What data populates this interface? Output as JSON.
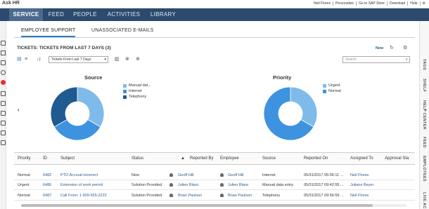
{
  "app": {
    "title": "Ask HR"
  },
  "utility": [
    "Neil Flores",
    "Personalize",
    "Go to SAP Store",
    "Download",
    "Help"
  ],
  "nav": [
    "SERVICE",
    "FEED",
    "PEOPLE",
    "ACTIVITIES",
    "LIBRARY"
  ],
  "subtabs": [
    "EMPLOYEE SUPPORT",
    "UNASSOCIATED E-MAILS"
  ],
  "tickets": {
    "title": "TICKETS: TICKETS FROM LAST 7 DAYS (3)",
    "new_label": "New"
  },
  "filter": {
    "selected": "Tickets From Last 7 Days"
  },
  "search": {
    "placeholder": "Search"
  },
  "charts": {
    "source": {
      "title": "Source",
      "legend": [
        "Manual dat...",
        "Internet",
        "Telephony"
      ],
      "colors": [
        "#7fbbea",
        "#3d93df",
        "#1f5a91"
      ],
      "values": [
        1,
        1,
        1
      ]
    },
    "priority": {
      "title": "Priority",
      "legend": [
        "Urgent",
        "Normal"
      ],
      "colors": [
        "#7fbbea",
        "#3d93df"
      ],
      "values": [
        1,
        2
      ]
    }
  },
  "table": {
    "headers": [
      "Priority",
      "ID",
      "Subject",
      "Status",
      "Reported By",
      "Employee",
      "Source",
      "Reported On",
      "Assigned To",
      "Approval Sta"
    ],
    "rows": [
      [
        "Normal",
        "6482",
        "PTO Accrual incorrect",
        "New",
        "Geoff Hill",
        "Geoff Hill",
        "Internet",
        "05/31/2017 05:06:11 ...",
        "Neil Flores"
      ],
      [
        "Urgent",
        "6486",
        "Extension of work permit",
        "Solution Provided",
        "Julien Blanc",
        "Julien Blanc",
        "Manual data entry",
        "05/31/2017 09:42:55 ...",
        "Juliane Beyer"
      ],
      [
        "Normal",
        "6487",
        "Call From: 1 609-555-2222",
        "Solution Provided",
        "Brian Paulsen",
        "Brian Paulsen",
        "Telephony",
        "05/31/2017 09:56:59 ...",
        "Neil Flores"
      ]
    ]
  },
  "right_rail": [
    "TAGS",
    "SHELF",
    "HELP CENTER",
    "FEED",
    "EMPLOYEES",
    "LIVE AC"
  ]
}
